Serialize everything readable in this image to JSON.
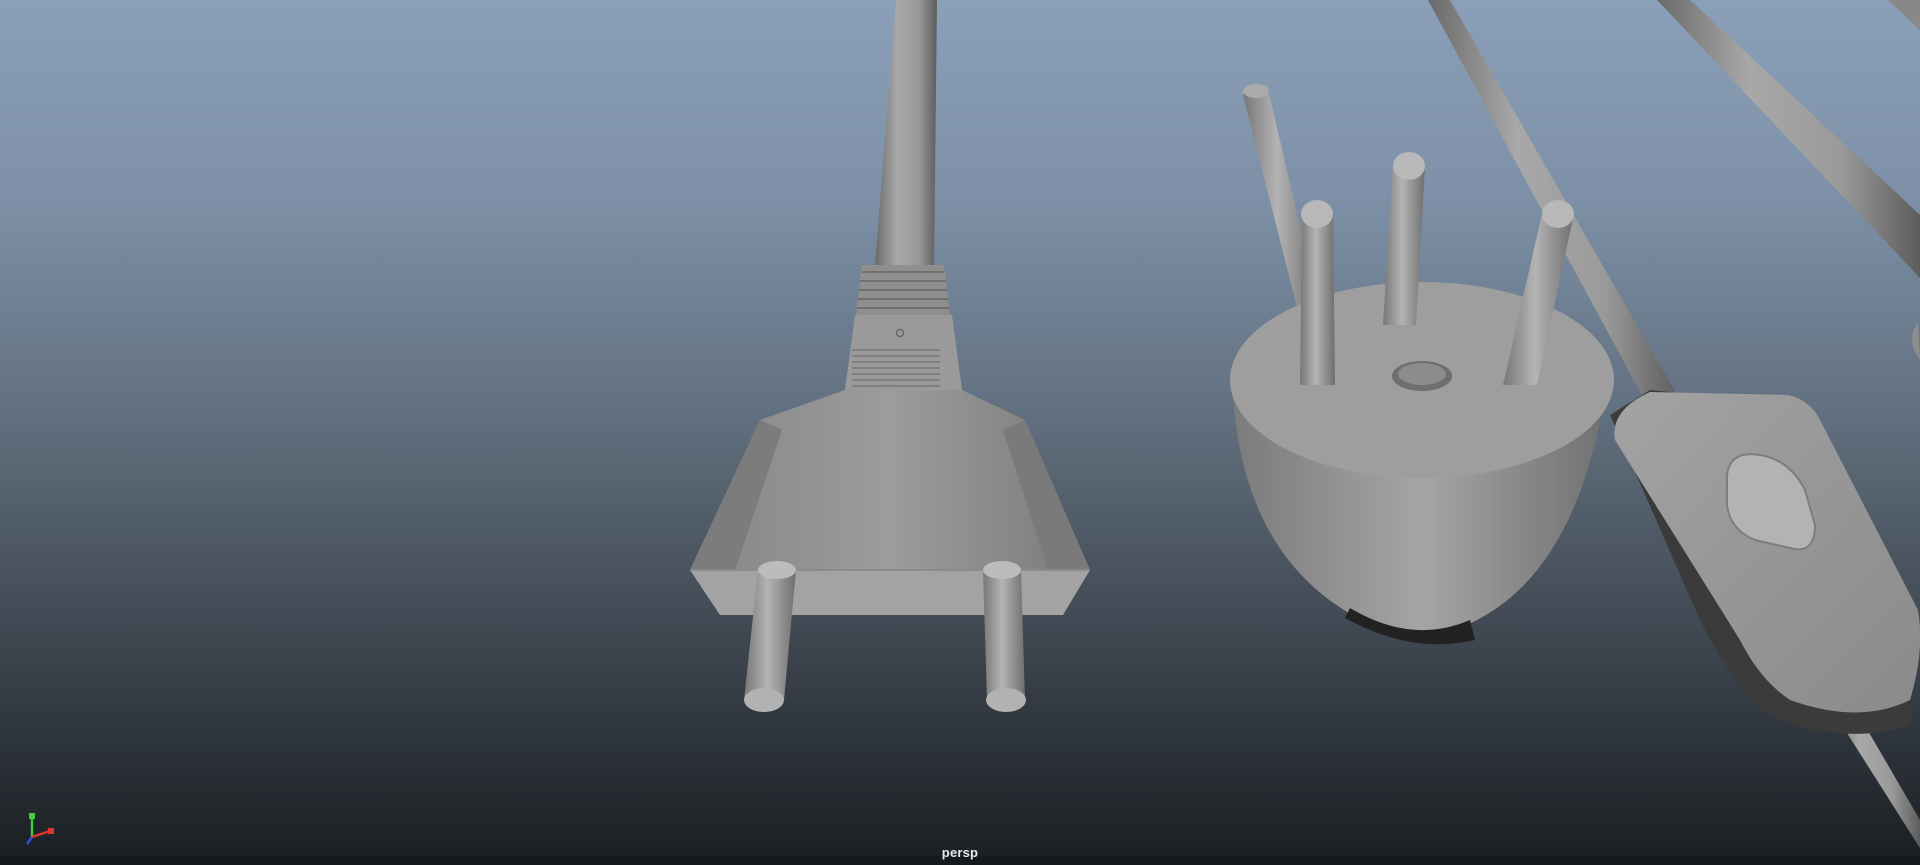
{
  "viewport": {
    "camera_name": "persp"
  },
  "scene_objects": [
    "two-pin-plug",
    "three-pin-round-plug",
    "inline-switch",
    "cable"
  ],
  "axis_gizmo": {
    "colors": {
      "x": "#e0332d",
      "y": "#3fcf3a",
      "z": "#3153e0"
    },
    "icon": "axis-gizmo-icon"
  }
}
